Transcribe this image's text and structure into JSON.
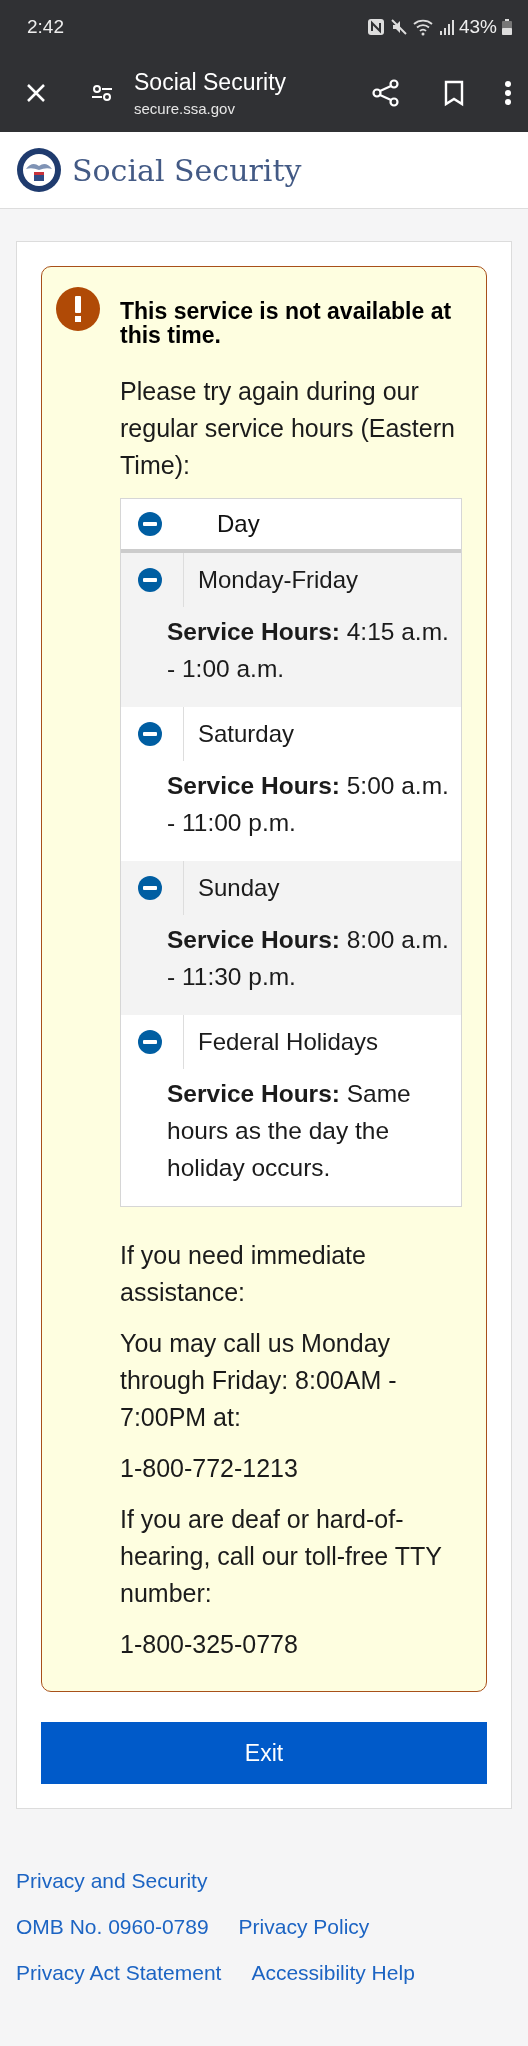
{
  "status_bar": {
    "time": "2:42",
    "battery": "43%"
  },
  "browser": {
    "title": "Social Security",
    "url": "secure.ssa.gov"
  },
  "site_header": {
    "title": "Social Security"
  },
  "alert": {
    "heading": "This service is not available at this time.",
    "intro": "Please try again during our regular service hours (Eastern Time):",
    "table": {
      "header": "Day",
      "header_expanded": true,
      "rows": [
        {
          "day": "Monday-Friday",
          "hours": "**Service Hours:** 4:15 a.m. - 1:00 a.m.",
          "expanded": true
        },
        {
          "day": "Saturday",
          "hours": "**Service Hours:** 5:00 a.m. - 11:00 p.m.",
          "expanded": true
        },
        {
          "day": "Sunday",
          "hours": "**Service Hours:** 8:00 a.m. - 11:30 p.m.",
          "expanded": true
        },
        {
          "day": "Federal Holidays",
          "hours": "**Service Hours:** Same hours as the day the holiday occurs.",
          "expanded": true
        }
      ]
    },
    "paragraphs": [
      "If you need immediate assistance:",
      "You may call us Monday through Friday: 8:00AM - 7:00PM at:",
      "1-800-772-1213",
      "If you are deaf or hard-of-hearing, call our toll-free TTY number:",
      "1-800-325-0778"
    ]
  },
  "exit_button": "Exit",
  "footer": {
    "rows": [
      [
        "Privacy and Security"
      ],
      [
        "OMB No. 0960-0789",
        "Privacy Policy"
      ],
      [
        "Privacy Act Statement",
        "Accessibility Help"
      ]
    ]
  }
}
